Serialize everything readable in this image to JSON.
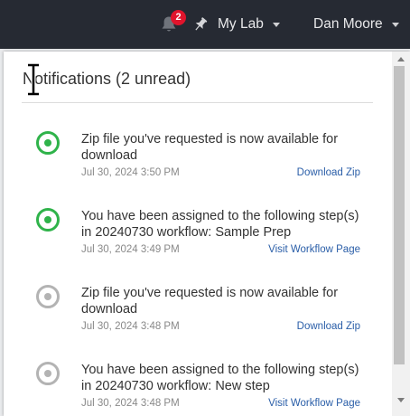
{
  "topbar": {
    "notification_count": "2",
    "lab_label": "My Lab",
    "user_label": "Dan Moore"
  },
  "panel": {
    "title": "Notifications (2 unread)",
    "notifications": [
      {
        "message": "Zip file you've requested is now available for download",
        "time": "Jul 30, 2024 3:50 PM",
        "action": "Download Zip",
        "unread": true
      },
      {
        "message": "You have been assigned to the following step(s) in 20240730 workflow: Sample Prep",
        "time": "Jul 30, 2024 3:49 PM",
        "action": "Visit Workflow Page",
        "unread": true
      },
      {
        "message": "Zip file you've requested is now available for download",
        "time": "Jul 30, 2024 3:48 PM",
        "action": "Download Zip",
        "unread": false
      },
      {
        "message": "You have been assigned to the following step(s) in 20240730 workflow: New step",
        "time": "Jul 30, 2024 3:48 PM",
        "action": "Visit Workflow Page",
        "unread": false
      }
    ]
  },
  "colors": {
    "topbar_bg": "#262a33",
    "badge": "#e0142c",
    "unread_status": "#2fb34a",
    "read_status": "#b3b3b3",
    "link": "#2a5ea8"
  }
}
